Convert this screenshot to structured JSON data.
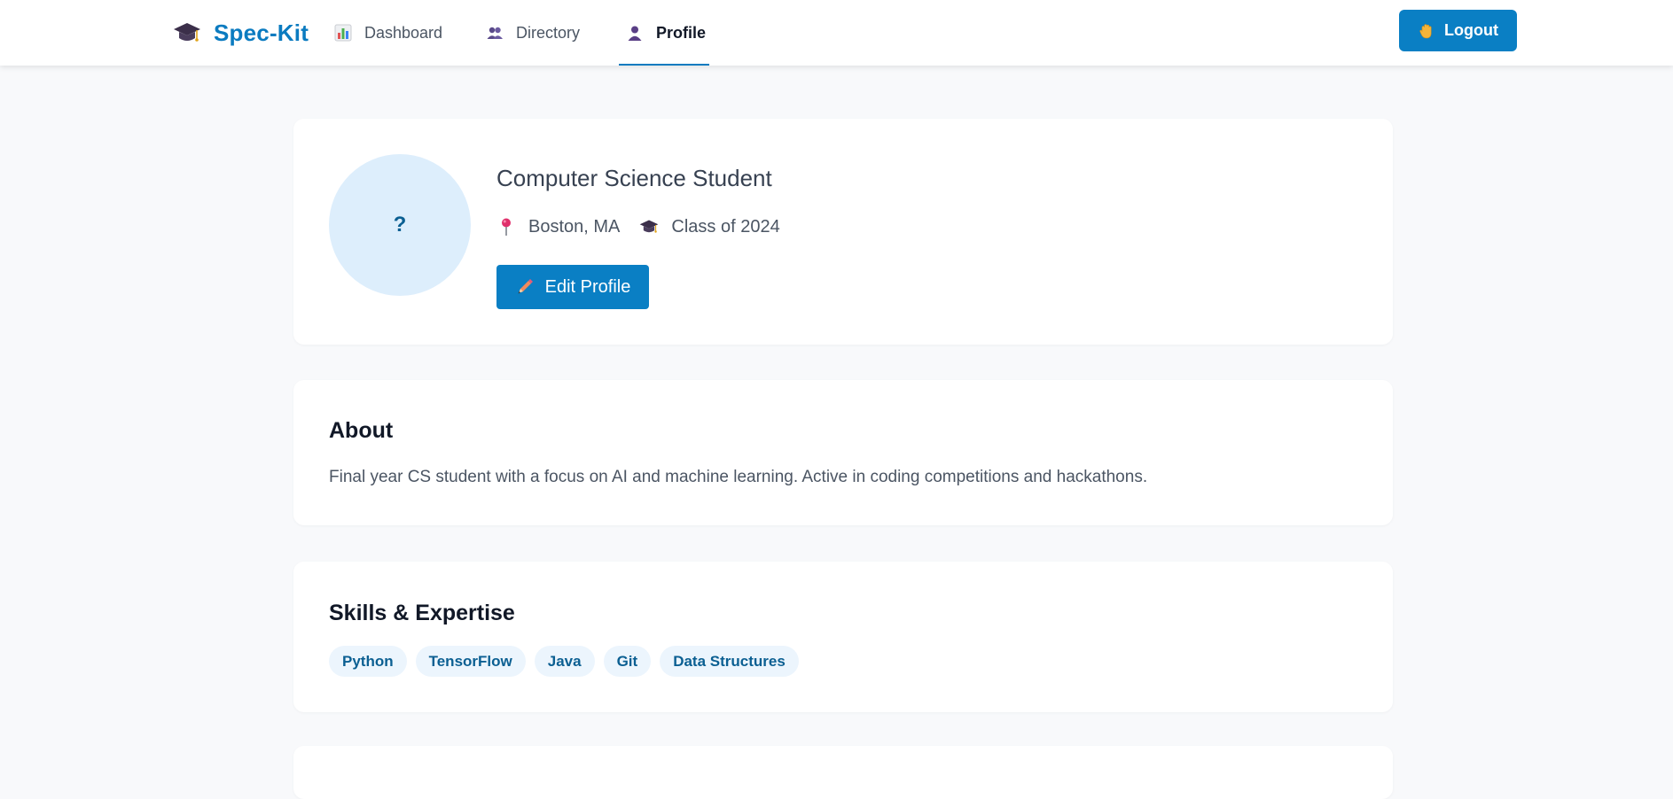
{
  "app": {
    "brand": "Spec-Kit",
    "accent_color": "#0a7fc4",
    "background_color": "#f8f9fb"
  },
  "nav": {
    "items": [
      {
        "label": "Dashboard",
        "icon": "bar-chart-icon",
        "active": false
      },
      {
        "label": "Directory",
        "icon": "people-icon",
        "active": false
      },
      {
        "label": "Profile",
        "icon": "person-icon",
        "active": true
      }
    ],
    "logout_label": "Logout",
    "logout_icon": "waving-hand-icon"
  },
  "profile": {
    "avatar_text": "?",
    "title": "Computer Science Student",
    "location": "Boston, MA",
    "location_icon": "pushpin-icon",
    "class_year": "Class of 2024",
    "class_icon": "graduation-cap-icon",
    "edit_label": "Edit Profile",
    "edit_icon": "pencil-icon"
  },
  "about": {
    "heading": "About",
    "text": "Final year CS student with a focus on AI and machine learning. Active in coding competitions and hackathons."
  },
  "skills": {
    "heading": "Skills & Expertise",
    "items": [
      "Python",
      "TensorFlow",
      "Java",
      "Git",
      "Data Structures"
    ]
  }
}
